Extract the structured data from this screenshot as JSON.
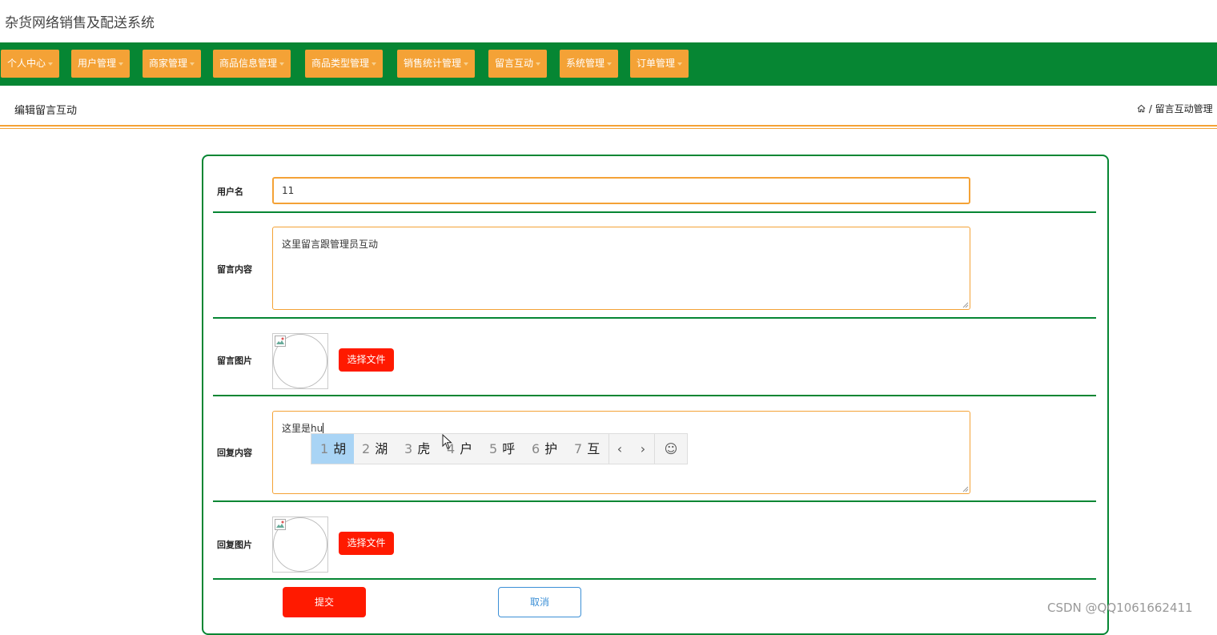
{
  "app": {
    "title": "杂货网络销售及配送系统"
  },
  "nav": {
    "items": [
      {
        "label": "个人中心"
      },
      {
        "label": "用户管理"
      },
      {
        "label": "商家管理"
      },
      {
        "label": "商品信息管理"
      },
      {
        "label": "商品类型管理"
      },
      {
        "label": "销售统计管理"
      },
      {
        "label": "留言互动"
      },
      {
        "label": "系统管理"
      },
      {
        "label": "订单管理"
      }
    ]
  },
  "subheader": {
    "page_title": "编辑留言互动",
    "breadcrumb": "/ 留言互动管理"
  },
  "form": {
    "username_label": "用户名",
    "username_value": "11",
    "message_label": "留言内容",
    "message_value": "这里留言跟管理员互动",
    "message_image_label": "留言图片",
    "choose_file_label": "选择文件",
    "reply_label": "回复内容",
    "reply_value_prefix": "这里是",
    "reply_value_composing": "hu",
    "reply_image_label": "回复图片",
    "submit_label": "提交",
    "cancel_label": "取消"
  },
  "ime": {
    "candidates": [
      {
        "num": "1",
        "text": "胡"
      },
      {
        "num": "2",
        "text": "湖"
      },
      {
        "num": "3",
        "text": "虎"
      },
      {
        "num": "4",
        "text": "户"
      },
      {
        "num": "5",
        "text": "呼"
      },
      {
        "num": "6",
        "text": "护"
      },
      {
        "num": "7",
        "text": "互"
      }
    ],
    "prev": "‹",
    "next": "›",
    "emoji": "☺"
  },
  "watermark": "CSDN @QQ1061662411",
  "colors": {
    "nav_bg": "#068633",
    "nav_item": "#f4a236",
    "primary_red": "#ff1a00",
    "cancel_blue": "#3b8fd6"
  }
}
